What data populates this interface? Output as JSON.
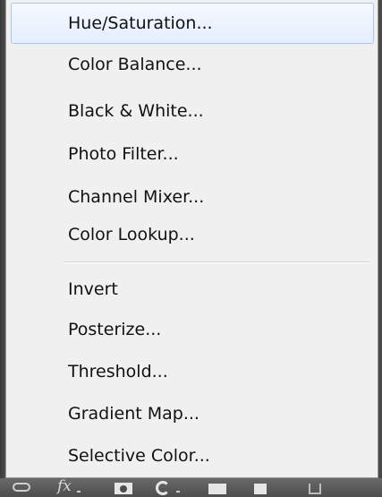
{
  "menu": {
    "items": [
      {
        "label": "Hue/Saturation...",
        "state": "hover"
      },
      {
        "label": "Color Balance..."
      },
      {
        "label": "Black & White..."
      },
      {
        "label": "Photo Filter..."
      },
      {
        "label": "Channel Mixer..."
      },
      {
        "label": "Color Lookup..."
      },
      {
        "label": "Invert"
      },
      {
        "label": "Posterize..."
      },
      {
        "label": "Threshold..."
      },
      {
        "label": "Gradient Map..."
      },
      {
        "label": "Selective Color..."
      }
    ]
  },
  "toolbar": {
    "icons": [
      "link-icon",
      "fx-icon",
      "layer-mask-icon",
      "adjustment-layer-icon",
      "group-folder-icon",
      "new-layer-icon",
      "trash-icon"
    ],
    "fx_label": "fx"
  },
  "colors": {
    "menu_background": "#f0f0f0",
    "hover_border": "#a9c8ec",
    "toolbar_background": "#4d4d4d"
  }
}
